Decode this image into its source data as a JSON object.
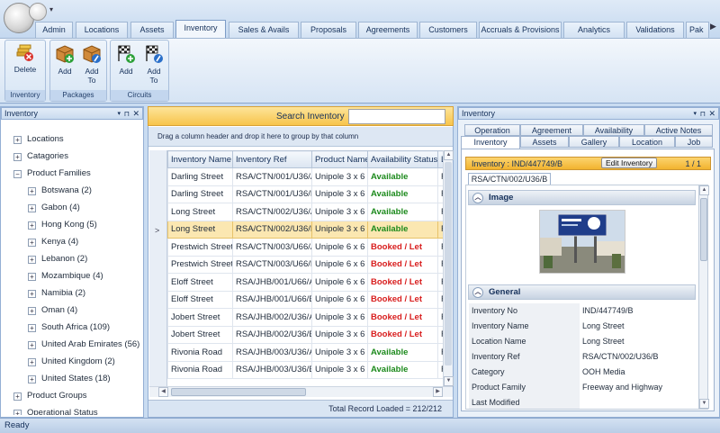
{
  "tabs": [
    "Admin",
    "Locations",
    "Assets",
    "Inventory",
    "Sales & Avails",
    "Proposals",
    "Agreements",
    "Customers",
    "Accruals & Provisions",
    "Analytics",
    "Validations",
    "Pak"
  ],
  "active_tab": "Inventory",
  "ribbon": {
    "groups": [
      {
        "caption": "Inventory",
        "buttons": [
          {
            "label": "Delete"
          }
        ]
      },
      {
        "caption": "Packages",
        "buttons": [
          {
            "label": "Add"
          },
          {
            "label": "Add To"
          }
        ]
      },
      {
        "caption": "Circuits",
        "buttons": [
          {
            "label": "Add"
          },
          {
            "label": "Add To"
          }
        ]
      }
    ]
  },
  "left_panel": {
    "title": "Inventory",
    "tree": [
      {
        "label": "Locations",
        "level": 0
      },
      {
        "label": "Catagories",
        "level": 0
      },
      {
        "label": "Product Families",
        "level": 0,
        "expanded": true
      },
      {
        "label": "Botswana (2)",
        "level": 1
      },
      {
        "label": "Gabon (4)",
        "level": 1
      },
      {
        "label": "Hong Kong (5)",
        "level": 1
      },
      {
        "label": "Kenya (4)",
        "level": 1
      },
      {
        "label": "Lebanon (2)",
        "level": 1
      },
      {
        "label": "Mozambique (4)",
        "level": 1
      },
      {
        "label": "Namibia (2)",
        "level": 1
      },
      {
        "label": "Oman (4)",
        "level": 1
      },
      {
        "label": "South Africa (109)",
        "level": 1
      },
      {
        "label": "United Arab Emirates (56)",
        "level": 1
      },
      {
        "label": "United Kingdom (2)",
        "level": 1
      },
      {
        "label": "United States (18)",
        "level": 1
      },
      {
        "label": "Product Groups",
        "level": 0
      },
      {
        "label": "Operational Status",
        "level": 0
      }
    ]
  },
  "grid": {
    "search_label": "Search Inventory",
    "search_value": "",
    "group_hint": "Drag a column header and drop it here to group by that column",
    "columns": [
      "Inventory Name",
      "Inventory Ref",
      "Product Name",
      "Availability Status",
      "L"
    ],
    "rows": [
      [
        "Darling Street",
        "RSA/CTN/001/U36/A",
        "Unipole 3 x 6",
        "Available",
        "R"
      ],
      [
        "Darling Street",
        "RSA/CTN/001/U36/B",
        "Unipole 3 x 6",
        "Available",
        "R"
      ],
      [
        "Long Street",
        "RSA/CTN/002/U36/A",
        "Unipole 3 x 6",
        "Available",
        "R"
      ],
      [
        "Long Street",
        "RSA/CTN/002/U36/B",
        "Unipole 3 x 6",
        "Available",
        "R"
      ],
      [
        "Prestwich Street",
        "RSA/CTN/003/U66/A",
        "Unipole 6 x 6",
        "Booked / Let",
        "R"
      ],
      [
        "Prestwich Street",
        "RSA/CTN/003/U66/B",
        "Unipole 6 x 6",
        "Booked / Let",
        "R"
      ],
      [
        "Eloff Street",
        "RSA/JHB/001/U66/A",
        "Unipole 6 x 6",
        "Booked / Let",
        "R"
      ],
      [
        "Eloff Street",
        "RSA/JHB/001/U66/B",
        "Unipole 6 x 6",
        "Booked / Let",
        "R"
      ],
      [
        "Jobert Street",
        "RSA/JHB/002/U36/A",
        "Unipole 3 x 6",
        "Booked / Let",
        "R"
      ],
      [
        "Jobert Street",
        "RSA/JHB/002/U36/B",
        "Unipole 3 x 6",
        "Booked / Let",
        "R"
      ],
      [
        "Rivonia Road",
        "RSA/JHB/003/U36/A",
        "Unipole 3 x 6",
        "Available",
        "R"
      ],
      [
        "Rivonia Road",
        "RSA/JHB/003/U36/B",
        "Unipole 3 x 6",
        "Available",
        "R"
      ]
    ],
    "selected_row": 3,
    "footer": "Total Record Loaded = 212/212"
  },
  "right_panel": {
    "title": "Inventory",
    "tabs_row1": [
      "Operation",
      "Agreement",
      "Availability",
      "Active Notes"
    ],
    "tabs_row2": [
      "Inventory",
      "Assets",
      "Gallery",
      "Location",
      "Job"
    ],
    "active_tab": "Inventory",
    "header": "Inventory : IND/447749/B",
    "edit_button": "Edit Inventory",
    "pager": "1 / 1",
    "sub_tab": "RSA/CTN/002/U36/B",
    "image_section": "Image",
    "general_section": "General",
    "properties": [
      {
        "label": "Inventory No",
        "value": "IND/447749/B"
      },
      {
        "label": "Inventory Name",
        "value": "Long Street"
      },
      {
        "label": "Location Name",
        "value": "Long Street"
      },
      {
        "label": "Inventory Ref",
        "value": "RSA/CTN/002/U36/B"
      },
      {
        "label": "Category",
        "value": "OOH Media"
      },
      {
        "label": "Product Family",
        "value": "Freeway and Highway"
      },
      {
        "label": "Last Modified",
        "value": ""
      }
    ]
  },
  "status": "Ready"
}
